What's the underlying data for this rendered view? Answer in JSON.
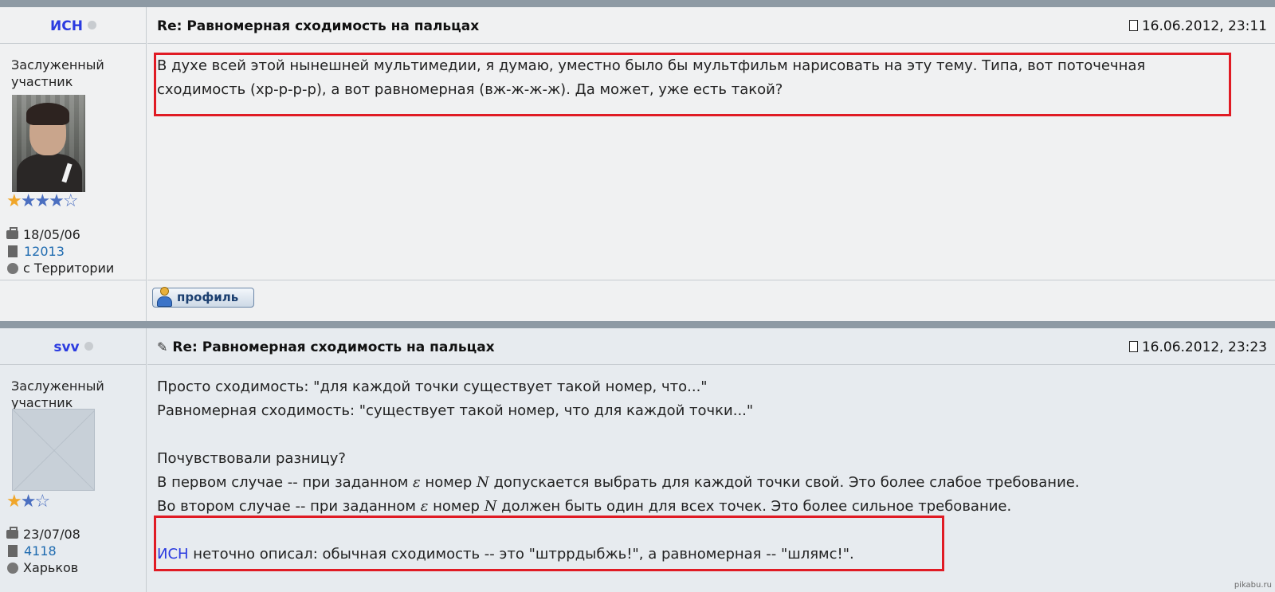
{
  "posts": [
    {
      "author": "ИСН",
      "title": "Re: Равномерная сходимость на пальцах",
      "date": "16.06.2012, 23:11",
      "rank_line1": "Заслуженный",
      "rank_line2": "участник",
      "stars": "★★★★☆",
      "registered": "18/05/06",
      "posts_count": "12013",
      "location": "с Территории",
      "message": "В духе всей этой нынешней мультимедии, я думаю, уместно было бы мультфильм нарисовать на эту тему. Типа, вот поточечная сходимость (хр-р-р-р), а вот равномерная (вж-ж-ж-ж). Да может, уже есть такой?",
      "profile_button": "профиль"
    },
    {
      "author": "svv",
      "title": "Re: Равномерная сходимость на пальцах",
      "date": "16.06.2012, 23:23",
      "rank_line1": "Заслуженный",
      "rank_line2": "участник",
      "stars": "★★☆",
      "registered": "23/07/08",
      "posts_count": "4118",
      "location": "Харьков",
      "lines": {
        "l1": "Просто сходимость: \"для каждой точки существует такой номер, что...\"",
        "l2": "Равномерная сходимость: \"существует такой номер, что для каждой точки...\"",
        "l4": "Почувствовали разницу?",
        "l5a": "В первом случае -- при заданном ",
        "l5eps": "ε",
        "l5b": " номер ",
        "l5n": "N",
        "l5c": " допускается выбрать для каждой точки свой. Это более слабое требование.",
        "l6a": "Во втором случае -- при заданном ",
        "l6eps": "ε",
        "l6b": " номер ",
        "l6n": "N",
        "l6c": " должен быть один для всех точек. Это более сильное требование.",
        "l8name": "ИСН",
        "l8rest": " неточно описал: обычная сходимость -- это \"штррдыбжь!\", а равномерная -- \"шлямс!\"."
      }
    }
  ],
  "watermark": "pikabu.ru",
  "colors": {
    "username": "#2b3be0",
    "link": "#1f6bb0",
    "highlight": "#e01b24",
    "star_gold": "#f0a62a",
    "star_blue": "#4b6fc0"
  }
}
